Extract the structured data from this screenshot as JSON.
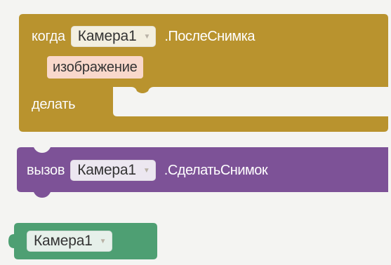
{
  "colors": {
    "event_block": "#b9932e",
    "call_block": "#7d5297",
    "component_block": "#4e9f73",
    "param_bg": "#f9d8cb",
    "page_bg": "#f4f4f2"
  },
  "event_block": {
    "when_keyword": "когда",
    "component_dropdown": {
      "selected": "Камера1",
      "icon": "dropdown-arrow-icon"
    },
    "event_name": ".ПослеСнимка",
    "parameter": "изображение",
    "do_keyword": "делать"
  },
  "call_block": {
    "call_keyword": "вызов",
    "component_dropdown": {
      "selected": "Камера1",
      "icon": "dropdown-arrow-icon"
    },
    "method_name": ".СделатьСнимок"
  },
  "component_block": {
    "component_dropdown": {
      "selected": "Камера1",
      "icon": "dropdown-arrow-icon"
    }
  }
}
